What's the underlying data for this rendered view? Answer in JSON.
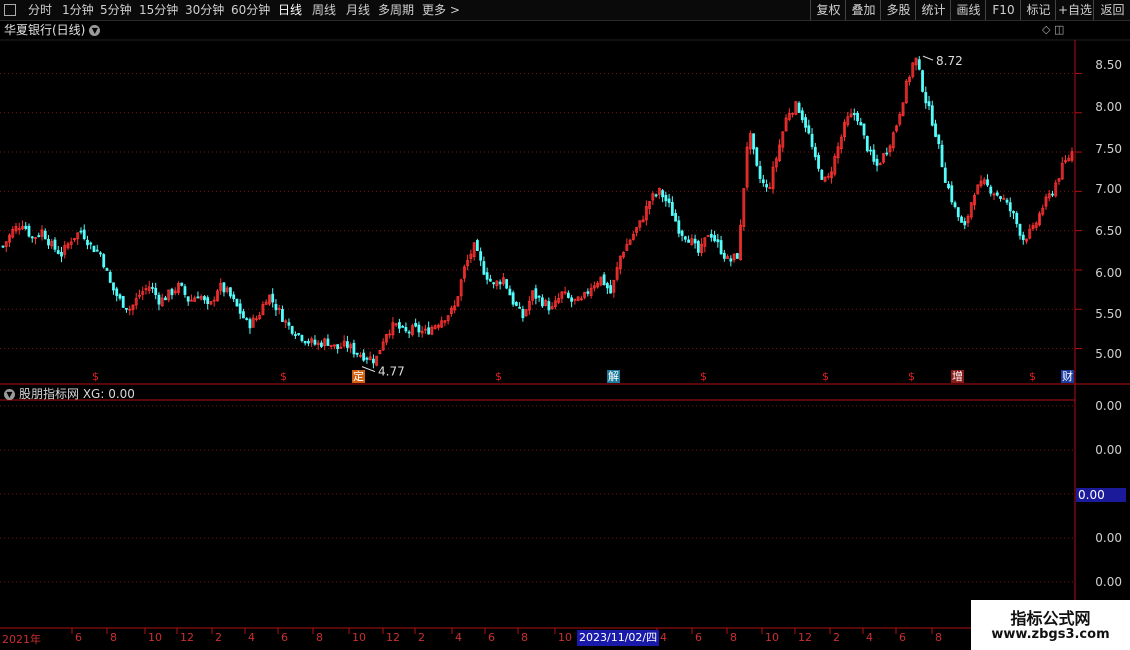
{
  "toolbar": {
    "periods": [
      "分时",
      "1分钟",
      "5分钟",
      "15分钟",
      "30分钟",
      "60分钟",
      "日线",
      "周线",
      "月线",
      "多周期",
      "更多 >"
    ],
    "active_period": "日线",
    "right_buttons": [
      "复权",
      "叠加",
      "多股",
      "统计",
      "画线",
      "F10",
      "标记",
      "+自选",
      "返回"
    ]
  },
  "chart_title": "华夏银行(日线)",
  "indicator_title": "股朋指标网 XG: 0.00",
  "price_axis": [
    "8.50",
    "8.00",
    "7.50",
    "7.00",
    "6.50",
    "6.00",
    "5.50",
    "5.00"
  ],
  "high_label": "8.72",
  "low_label": "4.77",
  "indicator_axis": [
    "0.00",
    "0.00",
    "0.00",
    "0.00",
    "0.00"
  ],
  "indicator_current": "0.00",
  "event_markers": [
    "$",
    "$",
    "定",
    "$",
    "解",
    "$",
    "$",
    "$",
    "增",
    "$",
    "财"
  ],
  "date_axis": [
    "2021年",
    "6",
    "8",
    "10",
    "12",
    "2",
    "4",
    "6",
    "8",
    "10",
    "12",
    "2",
    "4",
    "6",
    "8",
    "10",
    "2023/11/02/四",
    "4",
    "6",
    "8",
    "10",
    "12",
    "2",
    "4",
    "6",
    "8"
  ],
  "date_cursor": "2023/11/02/四",
  "watermark": {
    "line1": "指标公式网",
    "line2": "www.zbgs3.com"
  },
  "colors": {
    "up": "#ff3232",
    "down": "#54fcfc",
    "axis": "#b01010",
    "grid": "#7a1010"
  },
  "chart_data": {
    "type": "candlestick",
    "title": "华夏银行(日线)",
    "ylim": [
      4.6,
      8.9
    ],
    "high": 8.72,
    "low": 4.77,
    "close_path": [
      6.3,
      6.5,
      6.6,
      6.4,
      6.5,
      6.3,
      6.2,
      6.4,
      6.5,
      6.3,
      6.2,
      5.8,
      5.6,
      5.5,
      5.7,
      5.8,
      5.6,
      5.7,
      5.8,
      5.6,
      5.7,
      5.5,
      5.8,
      5.7,
      5.5,
      5.3,
      5.4,
      5.7,
      5.5,
      5.3,
      5.2,
      5.1,
      5.05,
      5.1,
      5.0,
      5.05,
      4.95,
      4.9,
      4.85,
      5.2,
      5.3,
      5.2,
      5.25,
      5.2,
      5.3,
      5.4,
      5.5,
      6.0,
      6.3,
      6.0,
      5.8,
      5.9,
      5.6,
      5.4,
      5.7,
      5.6,
      5.5,
      5.7,
      5.6,
      5.6,
      5.8,
      5.9,
      5.7,
      6.2,
      6.4,
      6.6,
      6.9,
      7.0,
      6.8,
      6.5,
      6.4,
      6.2,
      6.5,
      6.3,
      6.1,
      6.2,
      7.8,
      7.2,
      7.0,
      7.5,
      8.0,
      8.1,
      7.8,
      7.3,
      7.1,
      7.5,
      7.9,
      8.0,
      7.6,
      7.3,
      7.5,
      7.8,
      8.3,
      8.72,
      8.2,
      7.8,
      7.2,
      6.8,
      6.5,
      7.0,
      7.1,
      7.0,
      6.9,
      6.7,
      6.4,
      6.5,
      6.8,
      7.0,
      7.3,
      7.5
    ]
  }
}
